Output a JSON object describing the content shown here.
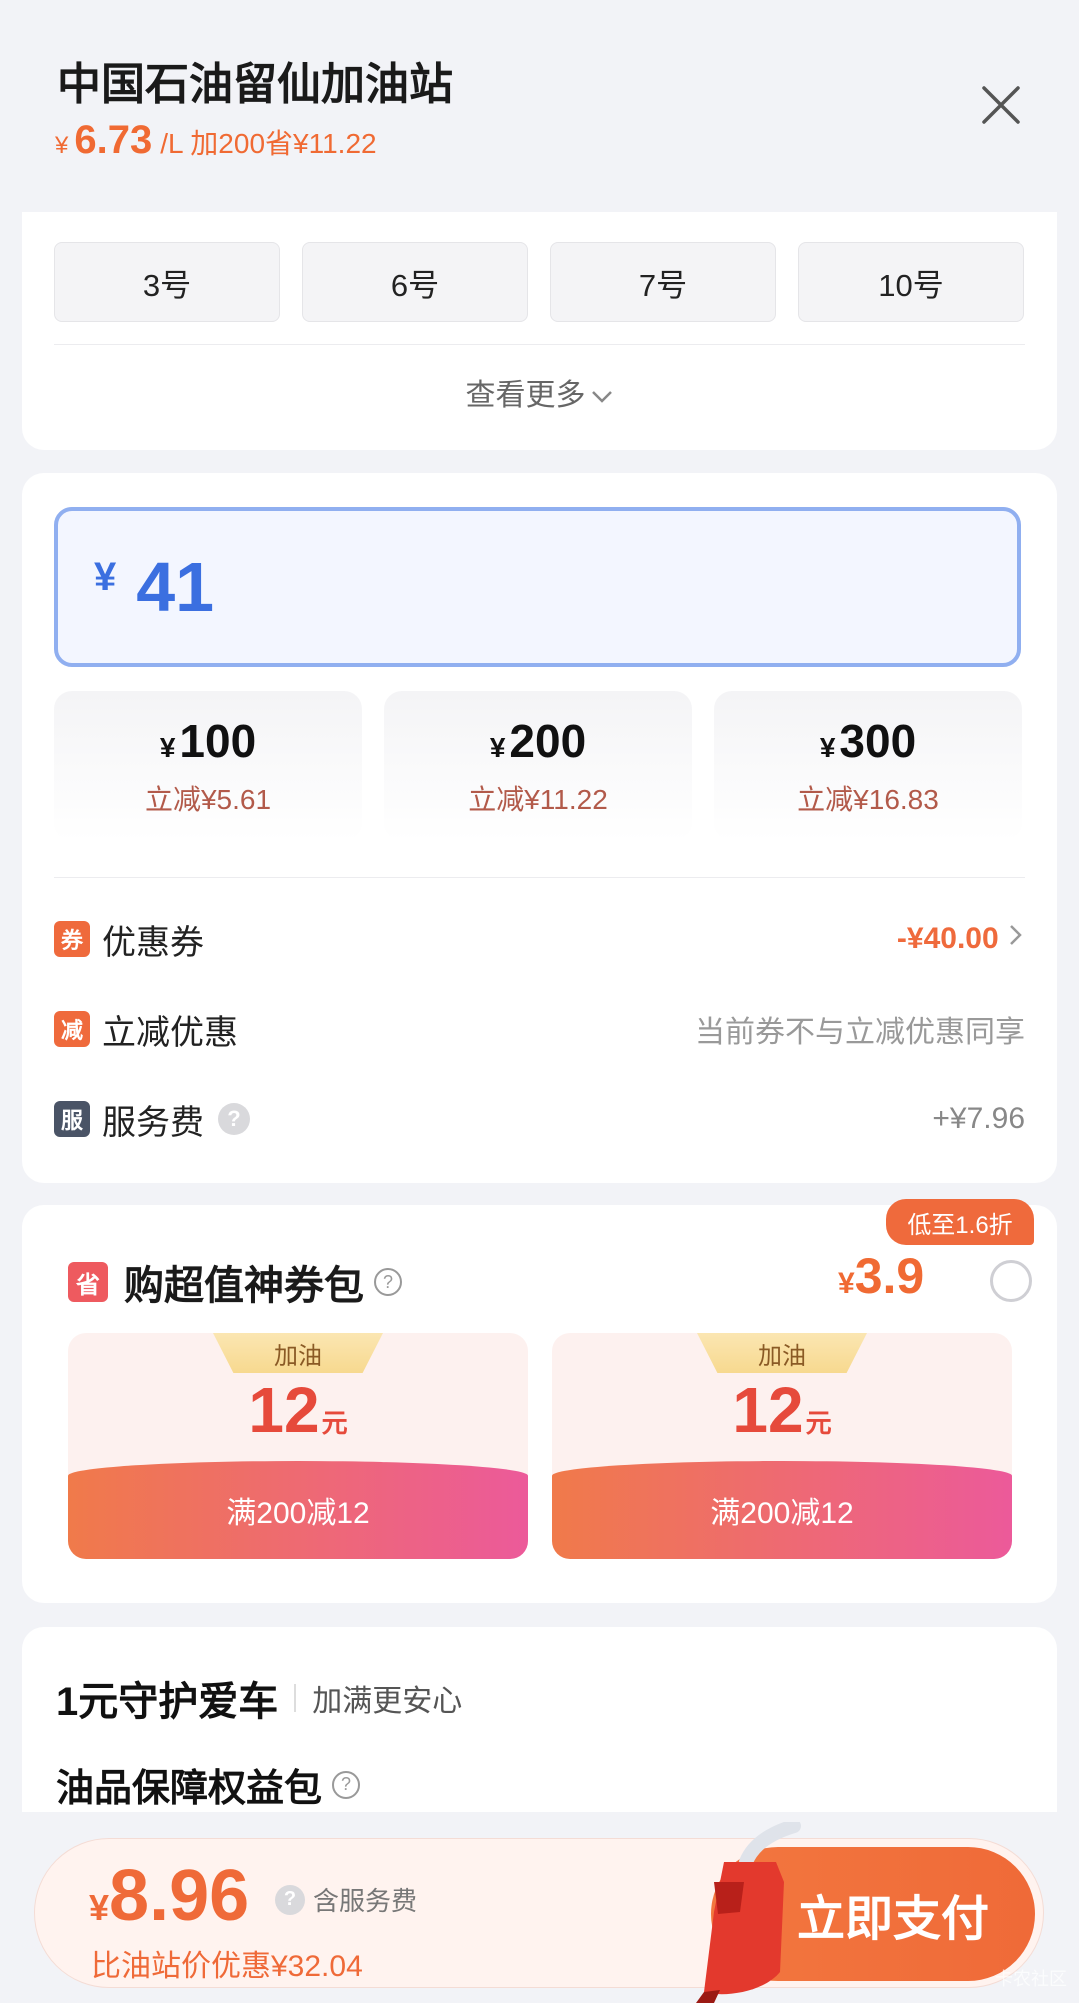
{
  "header": {
    "station_name": "中国石油留仙加油站",
    "yen": "¥",
    "price": "6.73",
    "unit_promo": "/L 加200省¥11.22"
  },
  "guns": {
    "items": [
      "3号",
      "6号",
      "7号",
      "10号"
    ],
    "see_more": "查看更多"
  },
  "amount": {
    "currency": "¥",
    "value": "41",
    "presets": [
      {
        "yen": "¥",
        "amount": "100",
        "discount": "立减¥5.61"
      },
      {
        "yen": "¥",
        "amount": "200",
        "discount": "立减¥11.22"
      },
      {
        "yen": "¥",
        "amount": "300",
        "discount": "立减¥16.83"
      }
    ]
  },
  "rows": {
    "coupon": {
      "tag": "券",
      "label": "优惠券",
      "value": "-¥40.00",
      "tag_color": "#ef6a3c",
      "value_color": "#ef6a3c"
    },
    "instant": {
      "tag": "减",
      "label": "立减优惠",
      "value": "当前券不与立减优惠同享",
      "tag_color": "#ef6a3c",
      "value_color": "#999999"
    },
    "service": {
      "tag": "服",
      "label": "服务费",
      "help": "?",
      "value": "+¥7.96",
      "tag_color": "#4a5466",
      "value_color": "#888888"
    }
  },
  "pack": {
    "badge": "低至1.6折",
    "tag": "省",
    "title": "购超值神券包",
    "help": "?",
    "yen": "¥",
    "price": "3.9",
    "checked": false,
    "vouchers": [
      {
        "category": "加油",
        "amount": "12",
        "unit": "元",
        "condition": "满200减12"
      },
      {
        "category": "加油",
        "amount": "12",
        "unit": "元",
        "condition": "满200减12"
      }
    ]
  },
  "guard": {
    "title": "1元守护爱车",
    "subtitle": "加满更安心",
    "package": "油品保障权益包",
    "help": "?"
  },
  "pay": {
    "yen": "¥",
    "price": "8.96",
    "help": "?",
    "fee_note": "含服务费",
    "saving": "比油站价优惠¥32.04",
    "button": "立即支付"
  },
  "watermark": "卡农社区"
}
